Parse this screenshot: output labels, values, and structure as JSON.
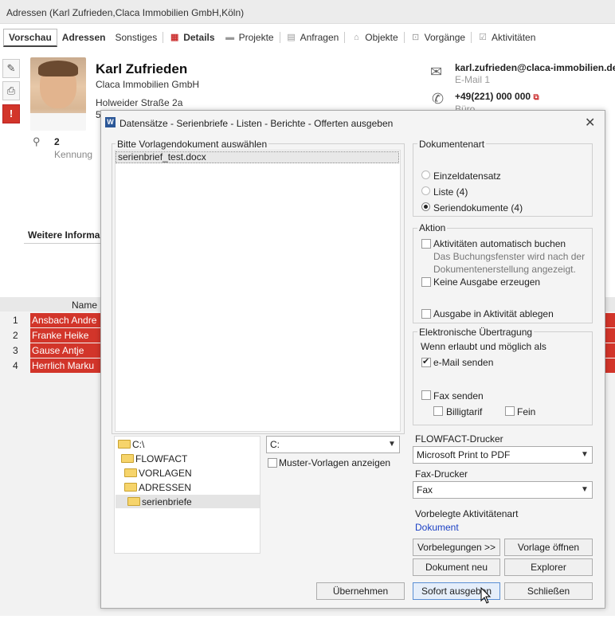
{
  "window_title": "Adressen (Karl Zufrieden,Claca Immobilien GmbH,Köln)",
  "tabs": [
    {
      "label": "Vorschau"
    },
    {
      "label": "Adressen"
    },
    {
      "label": "Sonstiges"
    },
    {
      "label": "Details"
    },
    {
      "label": "Projekte"
    },
    {
      "label": "Anfragen"
    },
    {
      "label": "Objekte"
    },
    {
      "label": "Vorgänge"
    },
    {
      "label": "Aktivitäten"
    }
  ],
  "contact": {
    "name": "Karl Zufrieden",
    "company": "Claca Immobilien GmbH",
    "street": "Holweider Straße 2a",
    "street2": "5",
    "email": "karl.zufrieden@claca-immobilien.de",
    "email_label": "E-Mail 1",
    "phone": "+49(221) 000 000",
    "phone_label": "Büro",
    "count": "2",
    "kennung": "Kennung",
    "weitere": "Weitere Informa"
  },
  "table": {
    "col_name": "Name",
    "rows": [
      {
        "num": "1",
        "name": "Ansbach Andre"
      },
      {
        "num": "2",
        "name": "Franke Heike"
      },
      {
        "num": "3",
        "name": "Gause Antje"
      },
      {
        "num": "4",
        "name": "Herrlich Marku"
      }
    ]
  },
  "dialog": {
    "title": "Datensätze - Serienbriefe - Listen - Berichte - Offerten ausgeben",
    "vorlage_legend": "Bitte Vorlagendokument auswählen",
    "file": "serienbrief_test.docx",
    "folders": [
      "C:\\",
      "FLOWFACT",
      "VORLAGEN",
      "ADRESSEN",
      "serienbriefe"
    ],
    "drive": "C:",
    "muster": "Muster-Vorlagen anzeigen",
    "dokumentenart": {
      "legend": "Dokumentenart",
      "options": [
        "Einzeldatensatz",
        "Liste (4)",
        "Seriendokumente (4)"
      ],
      "selected": 2
    },
    "aktion": {
      "legend": "Aktion",
      "items": [
        "Aktivitäten automatisch buchen",
        "Keine Ausgabe erzeugen",
        "Ausgabe in Aktivität ablegen"
      ],
      "hint1": "Das Buchungsfenster wird nach der",
      "hint2": "Dokumentenerstellung angezeigt."
    },
    "elektronisch": {
      "legend": "Elektronische Übertragung",
      "intro": "Wenn erlaubt und möglich als",
      "email": "e-Mail senden",
      "fax": "Fax senden",
      "billig": "Billigtarif",
      "fein": "Fein"
    },
    "drucker_label": "FLOWFACT-Drucker",
    "drucker": "Microsoft Print to PDF",
    "fax_label": "Fax-Drucker",
    "fax": "Fax",
    "akt_label": "Vorbelegte Aktivitätenart",
    "akt_value": "Dokument",
    "buttons": {
      "vorbelegungen": "Vorbelegungen >>",
      "vorlage": "Vorlage öffnen",
      "neu": "Dokument neu",
      "explorer": "Explorer",
      "uebernehmen": "Übernehmen",
      "sofort": "Sofort ausgeben",
      "schliessen": "Schließen"
    }
  }
}
